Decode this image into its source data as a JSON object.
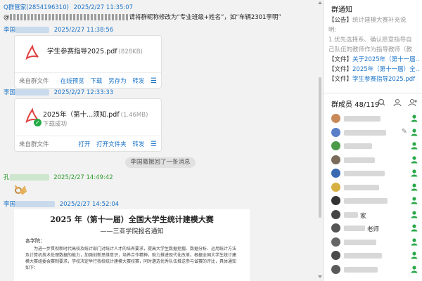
{
  "chat": {
    "messages": [
      {
        "sender": "Q群管家",
        "qq": "(2854196310)",
        "time": "2025/2/27 11:35:07",
        "text": "请将群昵称修改为“专业班级+姓名”，如“车辆2301李明”"
      },
      {
        "sender": "李国",
        "time": "2025/2/27 11:38:56",
        "file": {
          "name": "学生参赛指导2025.pdf",
          "size": "(828KB)",
          "source": "来自群文件",
          "actions": [
            "在线预览",
            "下载",
            "另存为",
            "转发"
          ]
        }
      },
      {
        "sender": "李国",
        "time": "2025/2/27 12:33:33",
        "file": {
          "name": "2025年（第十...须知.pdf",
          "size": "(1.46MB)",
          "status": "下载成功",
          "source": "来自群文件",
          "actions": [
            "打开",
            "打开文件夹",
            "转发"
          ]
        }
      },
      {
        "system": "李国徽撤回了一条消息"
      },
      {
        "sender": "孔",
        "time": "2025/2/27 14:49:42",
        "emoji": "ok-hand"
      },
      {
        "sender": "李国",
        "time": "2025/2/27 14:52:04",
        "doc": {
          "title": "2025 年（第十一届）全国大学生统计建模大赛",
          "subtitle": "——三亚学院报名通知",
          "salute": "各学院：",
          "body": "为进一步贯彻新时代高校及统计部门对统计人才的培养要求，提高大学生数据挖掘、数据分析、运用统计方法及计算机技术处理数据的能力，加强创新思维意识，培养合作精神，助力推进现代化改革。根据全国大学生统计建模大赛组委会赛制要求，学校决定举行我校统计建模大赛校赛，同时遴选优秀队伍推送参与省赛的评比，具体通知如下："
        }
      }
    ]
  },
  "side": {
    "notice_title": "群通知",
    "notices": [
      {
        "tag": "【公告】",
        "text": "统计建模大赛补充说",
        "style": "muted"
      },
      {
        "tag": "",
        "text": "明:",
        "style": "muted"
      },
      {
        "tag": "",
        "text": "1.优先选择系、确认愿意指导自",
        "style": "muted"
      },
      {
        "tag": "",
        "text": "己队伍的教师作为指导教师（教",
        "style": "muted"
      },
      {
        "tag": "【文件】",
        "text": "关于2025年（第十一届...",
        "style": "link"
      },
      {
        "tag": "【文件】",
        "text": "2025年（第十一届）全...",
        "style": "link"
      },
      {
        "tag": "【文件】",
        "text": "学生参赛指导2025.pdf",
        "style": "link"
      }
    ],
    "members_title": "群成员 48/119",
    "members": [
      {
        "name": "",
        "color": "#c98a5a"
      },
      {
        "name": "",
        "color": "#5a7fc9"
      },
      {
        "name": "",
        "color": "#4a9a4a"
      },
      {
        "name": "",
        "color": "#7a6a5a"
      },
      {
        "name": "",
        "color": "#3a6ab0"
      },
      {
        "name": "",
        "color": "#d6b040"
      },
      {
        "name": "",
        "color": "#333333"
      },
      {
        "name": "家",
        "color": "#444444"
      },
      {
        "name": "老师",
        "color": "#555555"
      },
      {
        "name": "",
        "color": "#666666"
      },
      {
        "name": "",
        "color": "#4a4a4a"
      },
      {
        "name": "",
        "color": "#5a5a5a"
      }
    ]
  },
  "colors": {
    "accent": "#1a73c8",
    "success": "#22aa44",
    "pdf": "#e04040"
  }
}
